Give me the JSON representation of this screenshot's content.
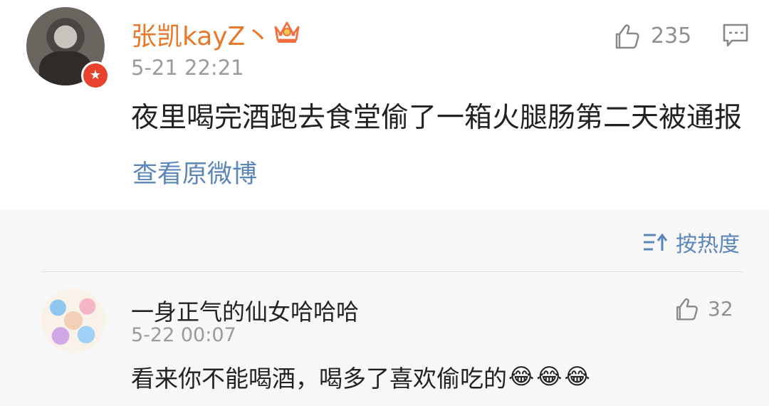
{
  "post": {
    "username": "张凯kayZ丶",
    "timestamp": "5-21 22:21",
    "likes": "235",
    "content": "夜里喝完酒跑去食堂偷了一箱火腿肠第二天被通报",
    "view_original": "查看原微博"
  },
  "sort": {
    "label": "按热度"
  },
  "comment": {
    "username": "一身正气的仙女哈哈哈",
    "timestamp": "5-22 00:07",
    "likes": "32",
    "content": "看来你不能喝酒，喝多了喜欢偷吃的",
    "emojis": [
      "😂",
      "😂",
      "😂"
    ]
  },
  "colors": {
    "username": "#e8782a",
    "link": "#5b86b8",
    "muted": "#9b9b9b",
    "text": "#222222",
    "verified": "#e8432f"
  },
  "icons": {
    "like": "thumbs-up-icon",
    "comment": "comment-icon",
    "sort": "sort-icon",
    "verified": "verified-badge-icon",
    "crown": "crown-icon"
  }
}
